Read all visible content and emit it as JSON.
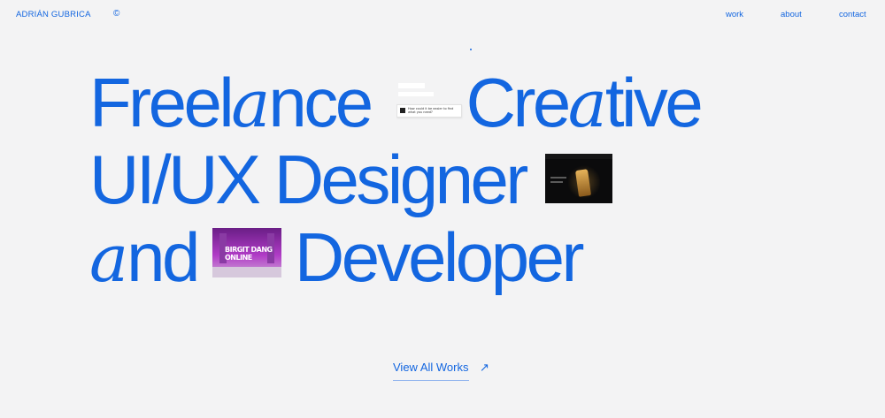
{
  "header": {
    "brand": "ADRIÁN GUBRICA",
    "copyright_symbol": "©",
    "nav": {
      "work": "work",
      "about": "about",
      "contact": "contact"
    }
  },
  "headline": {
    "line1": {
      "before": "Freel",
      "a": "a",
      "after": "nce",
      "word2_before": "Cre",
      "word2_a": "a",
      "word2_after": "tive"
    },
    "line2": {
      "text": "UI/UX Designer"
    },
    "line3": {
      "a": "a",
      "after": "nd",
      "word2": "Developer"
    }
  },
  "thumbnails": {
    "ui_card_text": "How could it be easier to find what you need?",
    "purple_label": "BIRGIT DANG ONLINE"
  },
  "cta": {
    "label": "View All Works",
    "arrow": "↗"
  },
  "colors": {
    "accent": "#1366e0",
    "background": "#f3f3f4"
  },
  "icons": {
    "arrow": "arrow-up-right-icon"
  }
}
